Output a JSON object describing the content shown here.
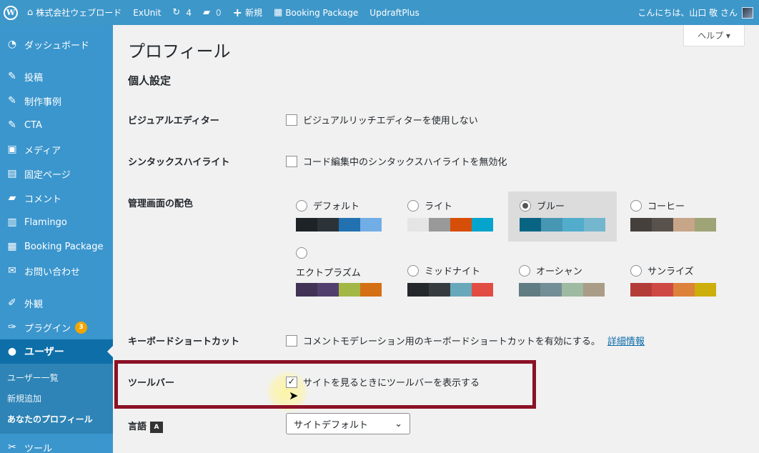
{
  "adminbar": {
    "site_name": "株式会社ウェブロード",
    "exunit": "ExUnit",
    "updates_count": "4",
    "comments_count": "0",
    "new_label": "新規",
    "booking": "Booking Package",
    "updraft": "UpdraftPlus",
    "greeting": "こんにちは、山口 敬 さん"
  },
  "sidebar": {
    "items": [
      {
        "label": "ダッシュボード"
      },
      {
        "label": "投稿"
      },
      {
        "label": "制作事例"
      },
      {
        "label": "CTA"
      },
      {
        "label": "メディア"
      },
      {
        "label": "固定ページ"
      },
      {
        "label": "コメント"
      },
      {
        "label": "Flamingo"
      },
      {
        "label": "Booking Package"
      },
      {
        "label": "お問い合わせ"
      },
      {
        "label": "外観"
      },
      {
        "label": "プラグイン",
        "badge": "3"
      },
      {
        "label": "ユーザー"
      },
      {
        "label": "ツール"
      }
    ],
    "submenu": [
      "ユーザー一覧",
      "新規追加",
      "あなたのプロフィール"
    ]
  },
  "help_label": "ヘルプ ▾",
  "page_title": "プロフィール",
  "section_title": "個人設定",
  "rows": {
    "visual_editor": {
      "label": "ビジュアルエディター",
      "option": "ビジュアルリッチエディターを使用しない",
      "checked": false
    },
    "syntax": {
      "label": "シンタックスハイライト",
      "option": "コード編集中のシンタックスハイライトを無効化",
      "checked": false
    },
    "color_scheme": {
      "label": "管理画面の配色"
    },
    "keyboard": {
      "label": "キーボードショートカット",
      "option": "コメントモデレーション用のキーボードショートカットを有効にする。",
      "link": "詳細情報",
      "checked": false
    },
    "toolbar": {
      "label": "ツールバー",
      "option": "サイトを見るときにツールバーを表示する",
      "checked": true
    },
    "language": {
      "label": "言語",
      "value": "サイトデフォルト"
    }
  },
  "schemes": [
    {
      "name": "デフォルト",
      "colors": [
        "#1d2327",
        "#2c3338",
        "#2271b1",
        "#72aee6"
      ],
      "selected": false
    },
    {
      "name": "ライト",
      "colors": [
        "#e5e5e5",
        "#999999",
        "#d64e07",
        "#04a4cc"
      ],
      "selected": false
    },
    {
      "name": "ブルー",
      "colors": [
        "#096484",
        "#4796b3",
        "#52accc",
        "#74b6ce"
      ],
      "selected": true
    },
    {
      "name": "コーヒー",
      "colors": [
        "#46403c",
        "#59524c",
        "#c7a589",
        "#9ea476"
      ],
      "selected": false
    },
    {
      "name": "エクトプラズム",
      "colors": [
        "#413256",
        "#523f6d",
        "#a3b745",
        "#d46f15"
      ],
      "selected": false
    },
    {
      "name": "ミッドナイト",
      "colors": [
        "#25282b",
        "#363b3f",
        "#69a8bb",
        "#e14d43"
      ],
      "selected": false
    },
    {
      "name": "オーシャン",
      "colors": [
        "#627c83",
        "#738e96",
        "#9ebaa0",
        "#aa9d88"
      ],
      "selected": false
    },
    {
      "name": "サンライズ",
      "colors": [
        "#b43c38",
        "#cf4944",
        "#dd823b",
        "#ccaf0b"
      ],
      "selected": false
    }
  ]
}
